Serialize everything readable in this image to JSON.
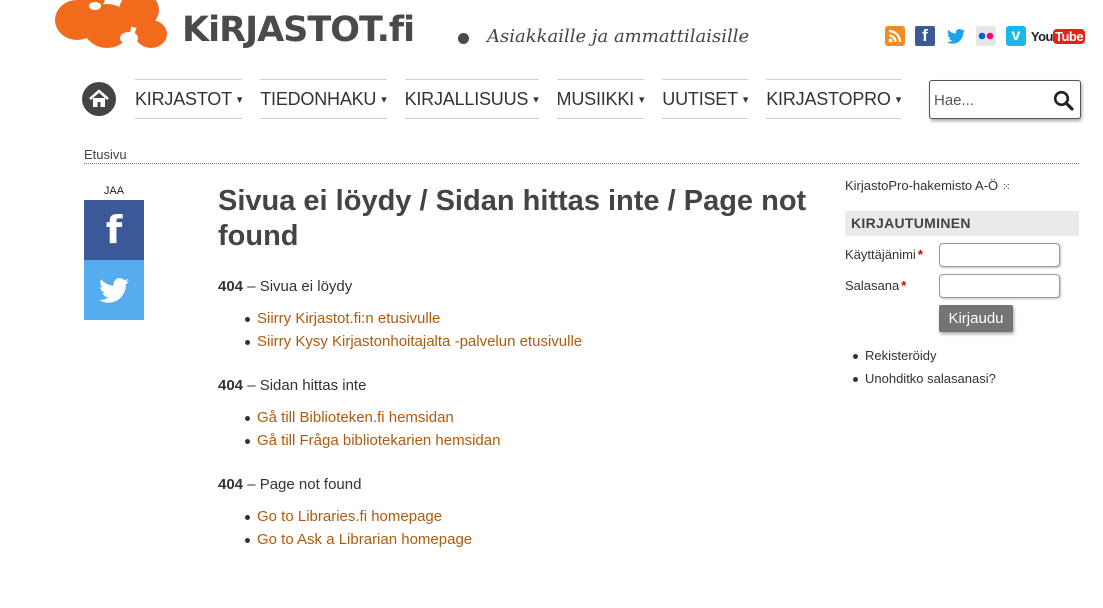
{
  "header": {
    "logo_text": "KiRJASTOT.fi",
    "tagline": "Asiakkaille ja ammattilaisille",
    "brand_color": "#f26b1d",
    "social": [
      "rss-icon",
      "facebook-icon",
      "twitter-icon",
      "flickr-icon",
      "vimeo-icon",
      "youtube-icon"
    ],
    "youtube_label_left": "You",
    "youtube_label_right": "Tube",
    "facebook_glyph": "f",
    "vimeo_glyph": "v"
  },
  "nav": {
    "items": [
      {
        "label": "KIRJASTOT"
      },
      {
        "label": "TIEDONHAKU"
      },
      {
        "label": "KIRJALLISUUS"
      },
      {
        "label": "MUSIIKKI"
      },
      {
        "label": "UUTISET"
      },
      {
        "label": "KIRJASTOPRO"
      }
    ],
    "caret": "▾"
  },
  "search": {
    "placeholder": "Hae..."
  },
  "breadcrumb": {
    "home": "Etusivu"
  },
  "share": {
    "label": "JAA",
    "facebook_glyph": "f"
  },
  "main": {
    "title": "Sivua ei löydy / Sidan hittas inte / Page not found",
    "sections": [
      {
        "code": "404",
        "text": " – Sivua ei löydy",
        "links": [
          "Siirry Kirjastot.fi:n etusivulle",
          "Siirry Kysy Kirjastonhoitajalta -palvelun etusivulle"
        ]
      },
      {
        "code": "404",
        "text": " – Sidan hittas inte",
        "links": [
          "Gå till Biblioteken.fi hemsidan",
          "Gå till Fråga bibliotekarien hemsidan"
        ]
      },
      {
        "code": "404",
        "text": " – Page not found",
        "links": [
          "Go to Libraries.fi homepage",
          "Go to Ask a Librarian homepage"
        ]
      }
    ],
    "link_color": "#b15a0d"
  },
  "sidebar": {
    "directory_link": "KirjastoPro-hakemisto A-Ö",
    "directory_dots": "⁙",
    "login": {
      "title": "KIRJAUTUMINEN",
      "username_label": "Käyttäjänimi",
      "password_label": "Salasana",
      "required_mark": "*",
      "submit": "Kirjaudu",
      "links": [
        "Rekisteröidy",
        "Unohditko salasanasi?"
      ]
    }
  }
}
